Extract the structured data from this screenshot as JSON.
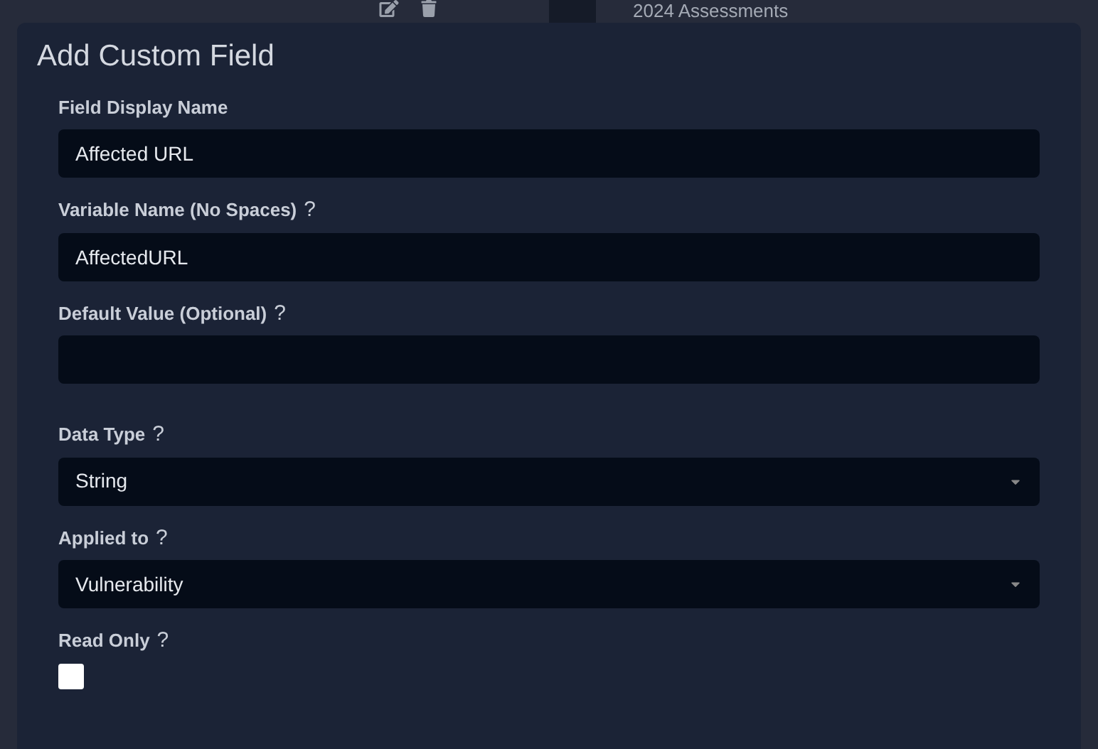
{
  "background": {
    "heading": "2024 Assessments"
  },
  "dialog": {
    "title": "Add Custom Field",
    "fields": [
      {
        "kind": "text",
        "label": "Field Display Name",
        "value": "Affected URL"
      },
      {
        "kind": "text",
        "label": "Variable Name (No Spaces)",
        "help": "?",
        "value": "AffectedURL"
      },
      {
        "kind": "text",
        "label": "Default Value (Optional)",
        "help": "?"
      },
      {
        "kind": "select",
        "label": "Data Type",
        "help": "?",
        "value": "String"
      },
      {
        "kind": "select",
        "label": "Applied to",
        "help": "?",
        "value": "Vulnerability"
      },
      {
        "kind": "checkbox",
        "label": "Read Only",
        "help": "?",
        "checked": false
      }
    ]
  }
}
